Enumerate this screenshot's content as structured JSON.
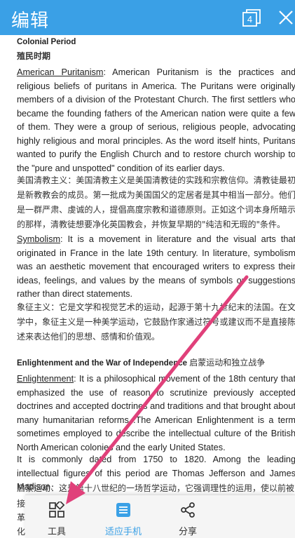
{
  "header": {
    "title": "编辑",
    "tab_count": "4"
  },
  "document": {
    "section1_title": "Colonial Period",
    "section1_title_cn": "殖民时期",
    "puritanism_term": "American Puritanism",
    "puritanism_text": ": American Puritanism is the practices and religious beliefs of puritans in America. The Puritans were originally members of a division of the Protestant Church.    The first settlers who became the founding fathers of the American nation were quite a few of them.    They were a group of serious, religious people, advocating highly religious and moral principles. As the word itself hints, Puritans wanted to purify the English Church and to restore church worship to the \"pure and unspotted\" condition of its earlier days.",
    "puritanism_cn": "美国清教主义：美国清教主义是美国清教徒的实践和宗教信仰。清教徒最初是新教教会的成员。第一批成为美国国父的定居者是其中相当一部分。他们是一群严肃、虔诚的人，提倡高度宗教和道德原则。正如这个词本身所暗示的那样，清教徒想要净化英国教会，并恢复早期的\"纯洁和无瑕的\"条件。",
    "symbolism_term": "Symbolism",
    "symbolism_text": ": It is a movement in literature and the visual arts that originated in France in the late 19th century. In literature, symbolism was an aesthetic movement that encouraged writers to express their ideas, feelings, and values by the means of symbols or suggestions rather than direct statements.",
    "symbolism_cn": "象征主义：它是文学和视觉艺术的运动，起源于第十九世纪末的法国。在文学中，象征主义是一种美学运动，它鼓励作家通过符号或建议而不是直接陈述来表达他们的思想、感情和价值观。",
    "section2_title": "Enlightenment and the War of Independence",
    "section2_title_cn": "启蒙运动和独立战争",
    "enlightenment_term": "Enlightenment",
    "enlightenment_text": ": It is a philosophical movement of the 18th century that emphasized the use of reason to scrutinize previously accepted doctrines and accepted doctrines and traditions and that brought about many humanitarian reforms .The American Enlightenment is a term sometimes employed to describe the intellectual culture of the British North American colonies and the early United States.",
    "dated_text": "It is commonly dated from 1750 to 1820. Among the leading intellectual figures of this period are Thomas Jefferson and James Madison.",
    "enlightenment_cn_line": "启蒙运动：这是第十八世纪的一场哲学运动，它强调理性的运用，使以前被",
    "cn_fragment_1": "接",
    "cn_fragment_2": "革",
    "cn_fragment_3": "化"
  },
  "toolbar": {
    "tools_label": "工具",
    "fit_label": "适应手机",
    "share_label": "分享",
    "accent": "#3aa0e6"
  },
  "annotation": {
    "arrow_color": "#e0407a"
  },
  "icons": [
    "tabs-icon",
    "close-icon",
    "grid-icon",
    "document-icon",
    "share-icon"
  ]
}
